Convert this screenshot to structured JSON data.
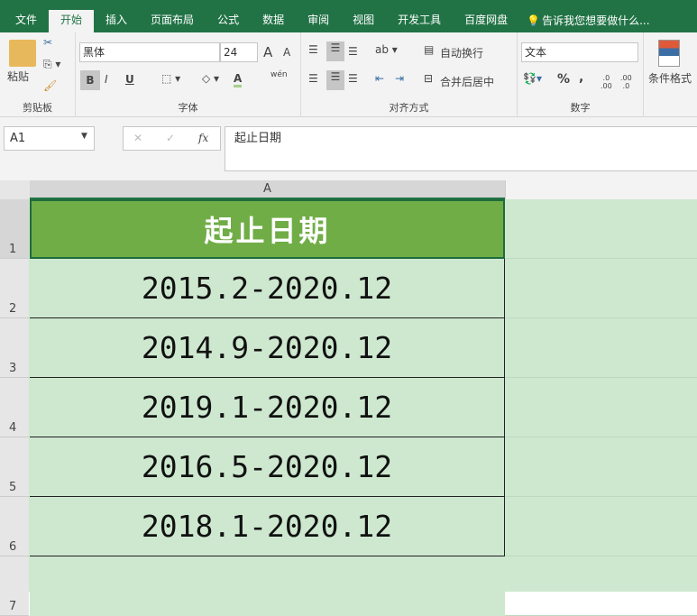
{
  "tabs": [
    "文件",
    "开始",
    "插入",
    "页面布局",
    "公式",
    "数据",
    "审阅",
    "视图",
    "开发工具",
    "百度网盘"
  ],
  "tell_me": "告诉我您想要做什么...",
  "ribbon": {
    "clipboard": {
      "paste": "粘贴",
      "label": "剪贴板"
    },
    "font": {
      "name": "黑体",
      "size": "24",
      "label": "字体",
      "bold": "B",
      "italic": "I",
      "underline": "U",
      "grow": "A",
      "shrink": "A",
      "font_color": "A",
      "phonetic": "wén"
    },
    "alignment": {
      "wrap": "自动换行",
      "merge": "合并后居中",
      "label": "对齐方式"
    },
    "number": {
      "format": "文本",
      "percent": "%",
      "comma": ",",
      "label": "数字"
    },
    "styles": {
      "conditional": "条件格式"
    }
  },
  "formula_bar": {
    "name_box": "A1",
    "content": "起止日期",
    "fx": "fx",
    "cancel": "✕",
    "enter": "✓"
  },
  "sheet": {
    "column": "A",
    "rows": [
      {
        "num": "1",
        "value": "起止日期"
      },
      {
        "num": "2",
        "value": "2015.2-2020.12"
      },
      {
        "num": "3",
        "value": "2014.9-2020.12"
      },
      {
        "num": "4",
        "value": "2019.1-2020.12"
      },
      {
        "num": "5",
        "value": "2016.5-2020.12"
      },
      {
        "num": "6",
        "value": "2018.1-2020.12"
      },
      {
        "num": "7",
        "value": ""
      }
    ]
  },
  "colors": {
    "ribbon": "#217346",
    "header_fill": "#70ad47",
    "data_fill": "#cde8cf"
  }
}
